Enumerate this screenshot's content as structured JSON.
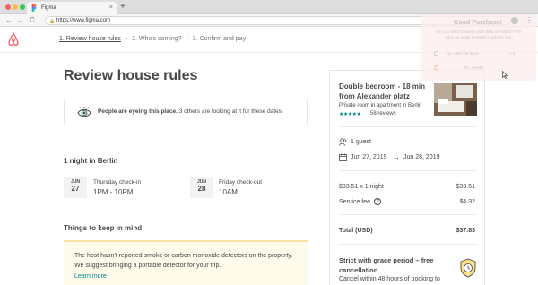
{
  "browser": {
    "tab_title": "Figma",
    "tab_close": "×",
    "new_tab": "+",
    "url": "https://www.figma.com",
    "back": "←",
    "forward": "→",
    "reload": "C",
    "menu": "⋮",
    "lock": "🔒",
    "traffic_colors": [
      "#fc605b",
      "#fdbc40",
      "#34c84a"
    ]
  },
  "steps": [
    {
      "label": "1. Review house rules",
      "active": true
    },
    {
      "label": "2. Who's coming?",
      "active": false
    },
    {
      "label": "3. Confirm and pay",
      "active": false
    }
  ],
  "step_separator": "›",
  "main": {
    "title": "Review house rules",
    "eye_bold": "People are eyeing this place.",
    "eye_rest": "3 others are looking at it for these dates.",
    "nights": "1 night in Berlin",
    "checkin": {
      "month": "JUN",
      "day": "27",
      "label": "Thursday check-in",
      "time": "1PM - 10PM"
    },
    "checkout": {
      "month": "JUN",
      "day": "28",
      "label": "Friday check-out",
      "time": "10AM"
    },
    "keep_title": "Things to keep in mind",
    "notice_text": "The host hasn't reported smoke or carbon monoxide detectors on the property. We suggest bringing a portable detector for your trip.",
    "notice_link": "Learn more"
  },
  "card": {
    "title": "Double bedroom - 18 min from Alexander platz",
    "subtitle": "Private room in apartment in Berlin",
    "stars": "★★★★★",
    "reviews": "58 reviews",
    "guests": "1 guest",
    "date_from": "Jun 27, 2019",
    "date_arrow": "→",
    "date_to": "Jun 28, 2019",
    "nightly_label": "$33.51 x 1 night",
    "nightly_value": "$33.51",
    "fee_label": "Service fee",
    "fee_info": "?",
    "fee_value": "$4.32",
    "total_label": "Total (USD)",
    "total_value": "$37.83",
    "grace_title": "Strict with grace period – free cancellation",
    "grace_sub": "Cancel within 48 hours of booking to"
  },
  "notification": {
    "title": "Good Purchase!",
    "body": "Do you want to delete your data on Airbnb? We have an email template ready for you.",
    "option1": "No, take me there",
    "option1_extra": "> 6",
    "option2": "No, thanks",
    "menu": "⋮"
  },
  "colors": {
    "brand": "#ff5a5f",
    "teal": "#008489",
    "text": "#484848"
  },
  "icons": [
    "airbnb-logo",
    "eye-icon",
    "guest-icon",
    "calendar-icon",
    "info-icon",
    "badge-icon",
    "cursor-icon"
  ]
}
